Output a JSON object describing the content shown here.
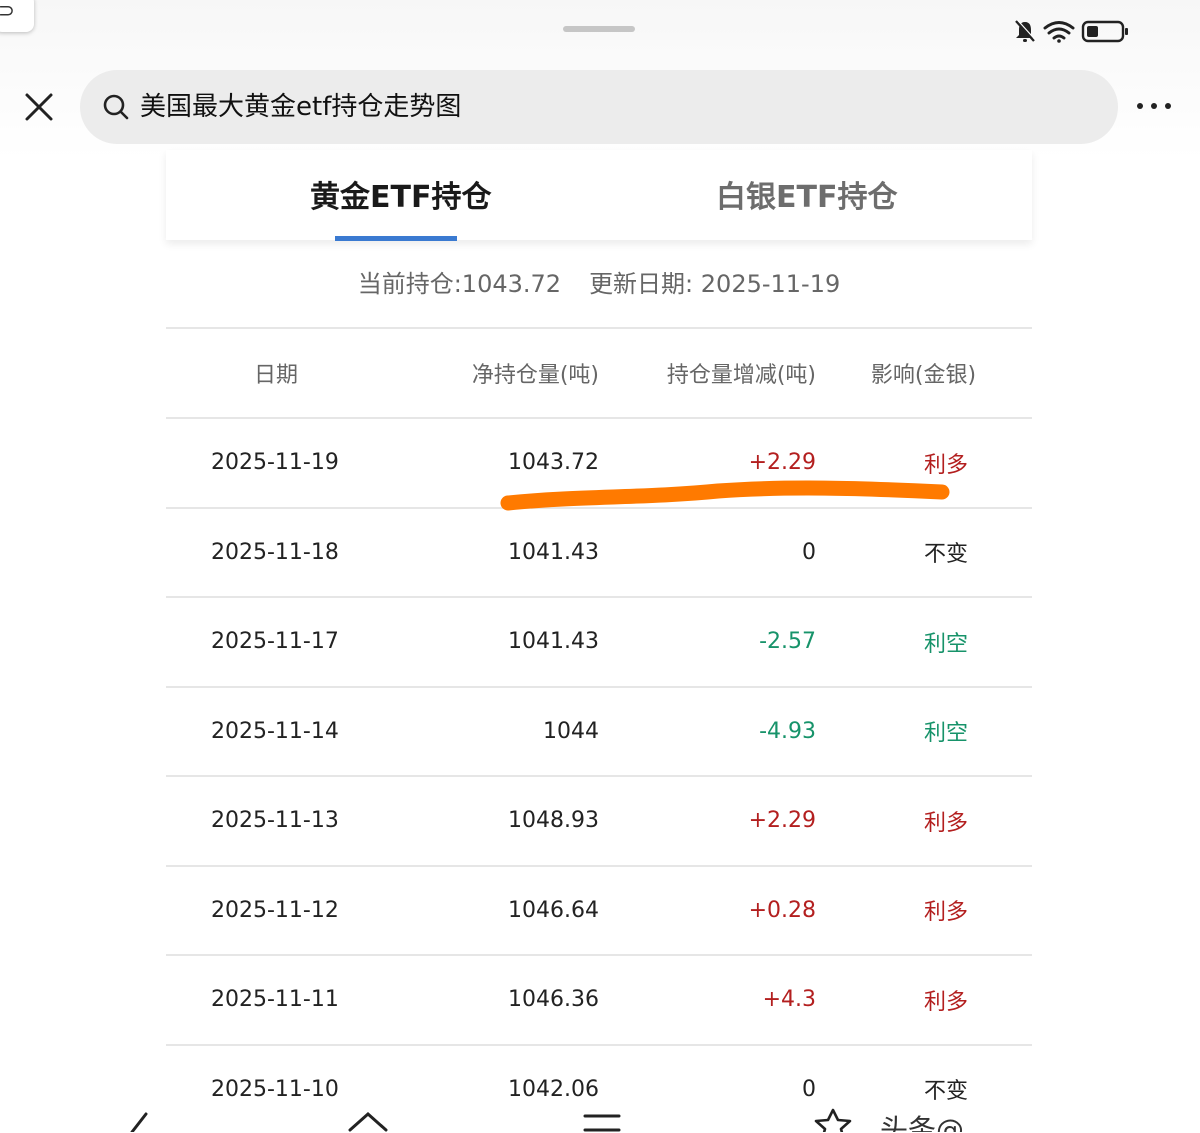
{
  "search": {
    "query": "美国最大黄金etf持仓走势图"
  },
  "tabs": [
    {
      "label": "黄金ETF持仓",
      "active": true
    },
    {
      "label": "白银ETF持仓",
      "active": false
    }
  ],
  "summary": {
    "current": "当前持仓:1043.72",
    "updated": "更新日期: 2025-11-19"
  },
  "table": {
    "headers": [
      "日期",
      "净持仓量(吨)",
      "持仓量增减(吨)",
      "影响(金银)"
    ],
    "rows": [
      {
        "date": "2025-11-19",
        "net": "1043.72",
        "change": "+2.29",
        "effect": "利多"
      },
      {
        "date": "2025-11-18",
        "net": "1041.43",
        "change": "0",
        "effect": "不变"
      },
      {
        "date": "2025-11-17",
        "net": "1041.43",
        "change": "-2.57",
        "effect": "利空"
      },
      {
        "date": "2025-11-14",
        "net": "1044",
        "change": "-4.93",
        "effect": "利空"
      },
      {
        "date": "2025-11-13",
        "net": "1048.93",
        "change": "+2.29",
        "effect": "利多"
      },
      {
        "date": "2025-11-12",
        "net": "1046.64",
        "change": "+0.28",
        "effect": "利多"
      },
      {
        "date": "2025-11-11",
        "net": "1046.36",
        "change": "+4.3",
        "effect": "利多"
      },
      {
        "date": "2025-11-10",
        "net": "1042.06",
        "change": "0",
        "effect": "不变"
      }
    ]
  },
  "colors": {
    "up": "#b31f1f",
    "down": "#17936a",
    "tab_active_underline": "#3a7ad1",
    "highlight_stroke": "#ff7a00"
  },
  "icons": [
    "close-icon",
    "search-icon",
    "more-icon",
    "mute-icon",
    "wifi-icon",
    "battery-icon",
    "back-icon",
    "home-icon",
    "menu-icon",
    "star-icon"
  ],
  "watermark": "头条@"
}
